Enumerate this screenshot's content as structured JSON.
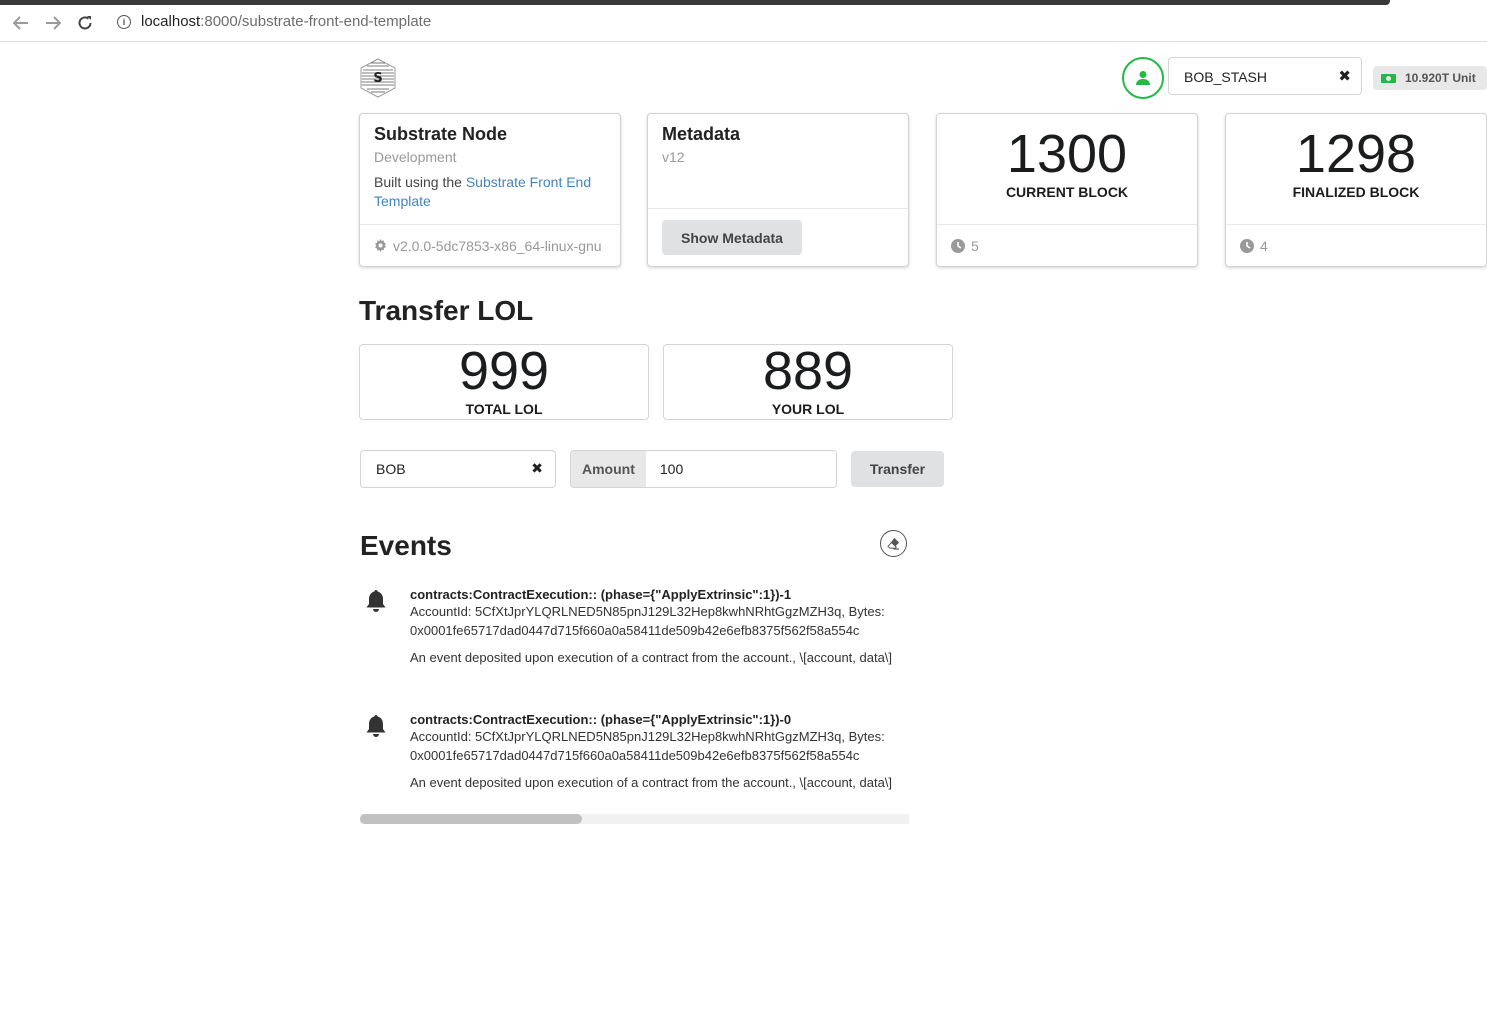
{
  "browser": {
    "url_host": "localhost",
    "url_path": ":8000/substrate-front-end-template"
  },
  "header": {
    "account": "BOB_STASH",
    "balance": "10.920T Unit"
  },
  "node_card": {
    "title": "Substrate Node",
    "chain": "Development",
    "desc_prefix": "Built using the ",
    "desc_link": "Substrate Front End Template",
    "version": "v2.0.0-5dc7853-x86_64-linux-gnu"
  },
  "metadata_card": {
    "title": "Metadata",
    "version": "v12",
    "button": "Show Metadata"
  },
  "current_block": {
    "value": "1300",
    "label": "CURRENT BLOCK",
    "timer": "5"
  },
  "finalized_block": {
    "value": "1298",
    "label": "FINALIZED BLOCK",
    "timer": "4"
  },
  "transfer": {
    "title": "Transfer LOL",
    "total_value": "999",
    "total_label": "TOTAL LOL",
    "your_value": "889",
    "your_label": "YOUR LOL",
    "to_account": "BOB",
    "amount_label": "Amount",
    "amount_value": "100",
    "button": "Transfer"
  },
  "events": {
    "title": "Events",
    "items": [
      {
        "summary": "contracts:ContractExecution:: (phase={\"ApplyExtrinsic\":1})-1",
        "data1": "AccountId: 5CfXtJprYLQRLNED5N85pnJ129L32Hep8kwhNRhtGgzMZH3q, Bytes:",
        "data2": "0x0001fe65717dad0447d715f660a0a58411de509b42e6efb8375f562f58a554c",
        "doc": "An event deposited upon execution of a contract from the account., \\[account, data\\]"
      },
      {
        "summary": "contracts:ContractExecution:: (phase={\"ApplyExtrinsic\":1})-0",
        "data1": "AccountId: 5CfXtJprYLQRLNED5N85pnJ129L32Hep8kwhNRhtGgzMZH3q, Bytes:",
        "data2": "0x0001fe65717dad0447d715f660a0a58411de509b42e6efb8375f562f58a554c",
        "doc": "An event deposited upon execution of a contract from the account., \\[account, data\\]"
      }
    ]
  },
  "icons": {
    "back": "arrow-left-icon",
    "forward": "arrow-right-icon",
    "reload": "reload-icon",
    "info": "info-icon",
    "logo": "substrate-logo",
    "user": "user-icon",
    "money": "money-icon",
    "settings": "gear-icon",
    "time": "clock-icon",
    "bell": "bell-icon",
    "erase": "eraser-icon"
  },
  "colors": {
    "accent_green": "#21ba45",
    "link_blue": "#4183c4",
    "button_grey": "#e0e1e2"
  }
}
